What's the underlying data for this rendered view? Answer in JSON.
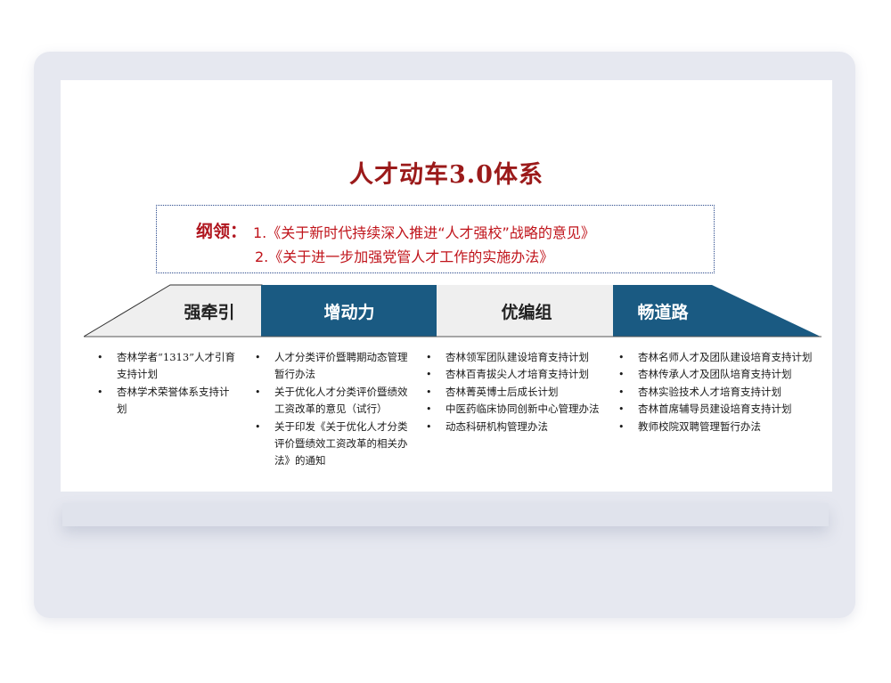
{
  "title": "人才动车3.0体系",
  "guideline": {
    "label": "纲领：",
    "lines": [
      "1.《关于新时代持续深入推进“人才强校”战略的意见》",
      "2.《关于进一步加强党管人才工作的实施办法》"
    ]
  },
  "colors": {
    "dark_blue": "#1a5a82",
    "light_gray": "#efefef",
    "title_red": "#9b1a1a"
  },
  "pillars": [
    {
      "label": "强牵引",
      "items": [
        "杏林学者“1313”人才引育支持计划",
        "杏林学术荣誉体系支持计划"
      ]
    },
    {
      "label": "增动力",
      "items": [
        "人才分类评价暨聘期动态管理暂行办法",
        "关于优化人才分类评价暨绩效工资改革的意见（试行）",
        "关于印发《关于优化人才分类评价暨绩效工资改革的相关办法》的通知"
      ]
    },
    {
      "label": "优编组",
      "items": [
        "杏林领军团队建设培育支持计划",
        "杏林百青拔尖人才培育支持计划",
        "杏林菁英博士后成长计划",
        "中医药临床协同创新中心管理办法",
        "动态科研机构管理办法"
      ]
    },
    {
      "label": "畅道路",
      "items": [
        "杏林名师人才及团队建设培育支持计划",
        "杏林传承人才及团队培育支持计划",
        "杏林实验技术人才培育支持计划",
        "杏林首席辅导员建设培育支持计划",
        "教师校院双聘管理暂行办法"
      ]
    }
  ]
}
